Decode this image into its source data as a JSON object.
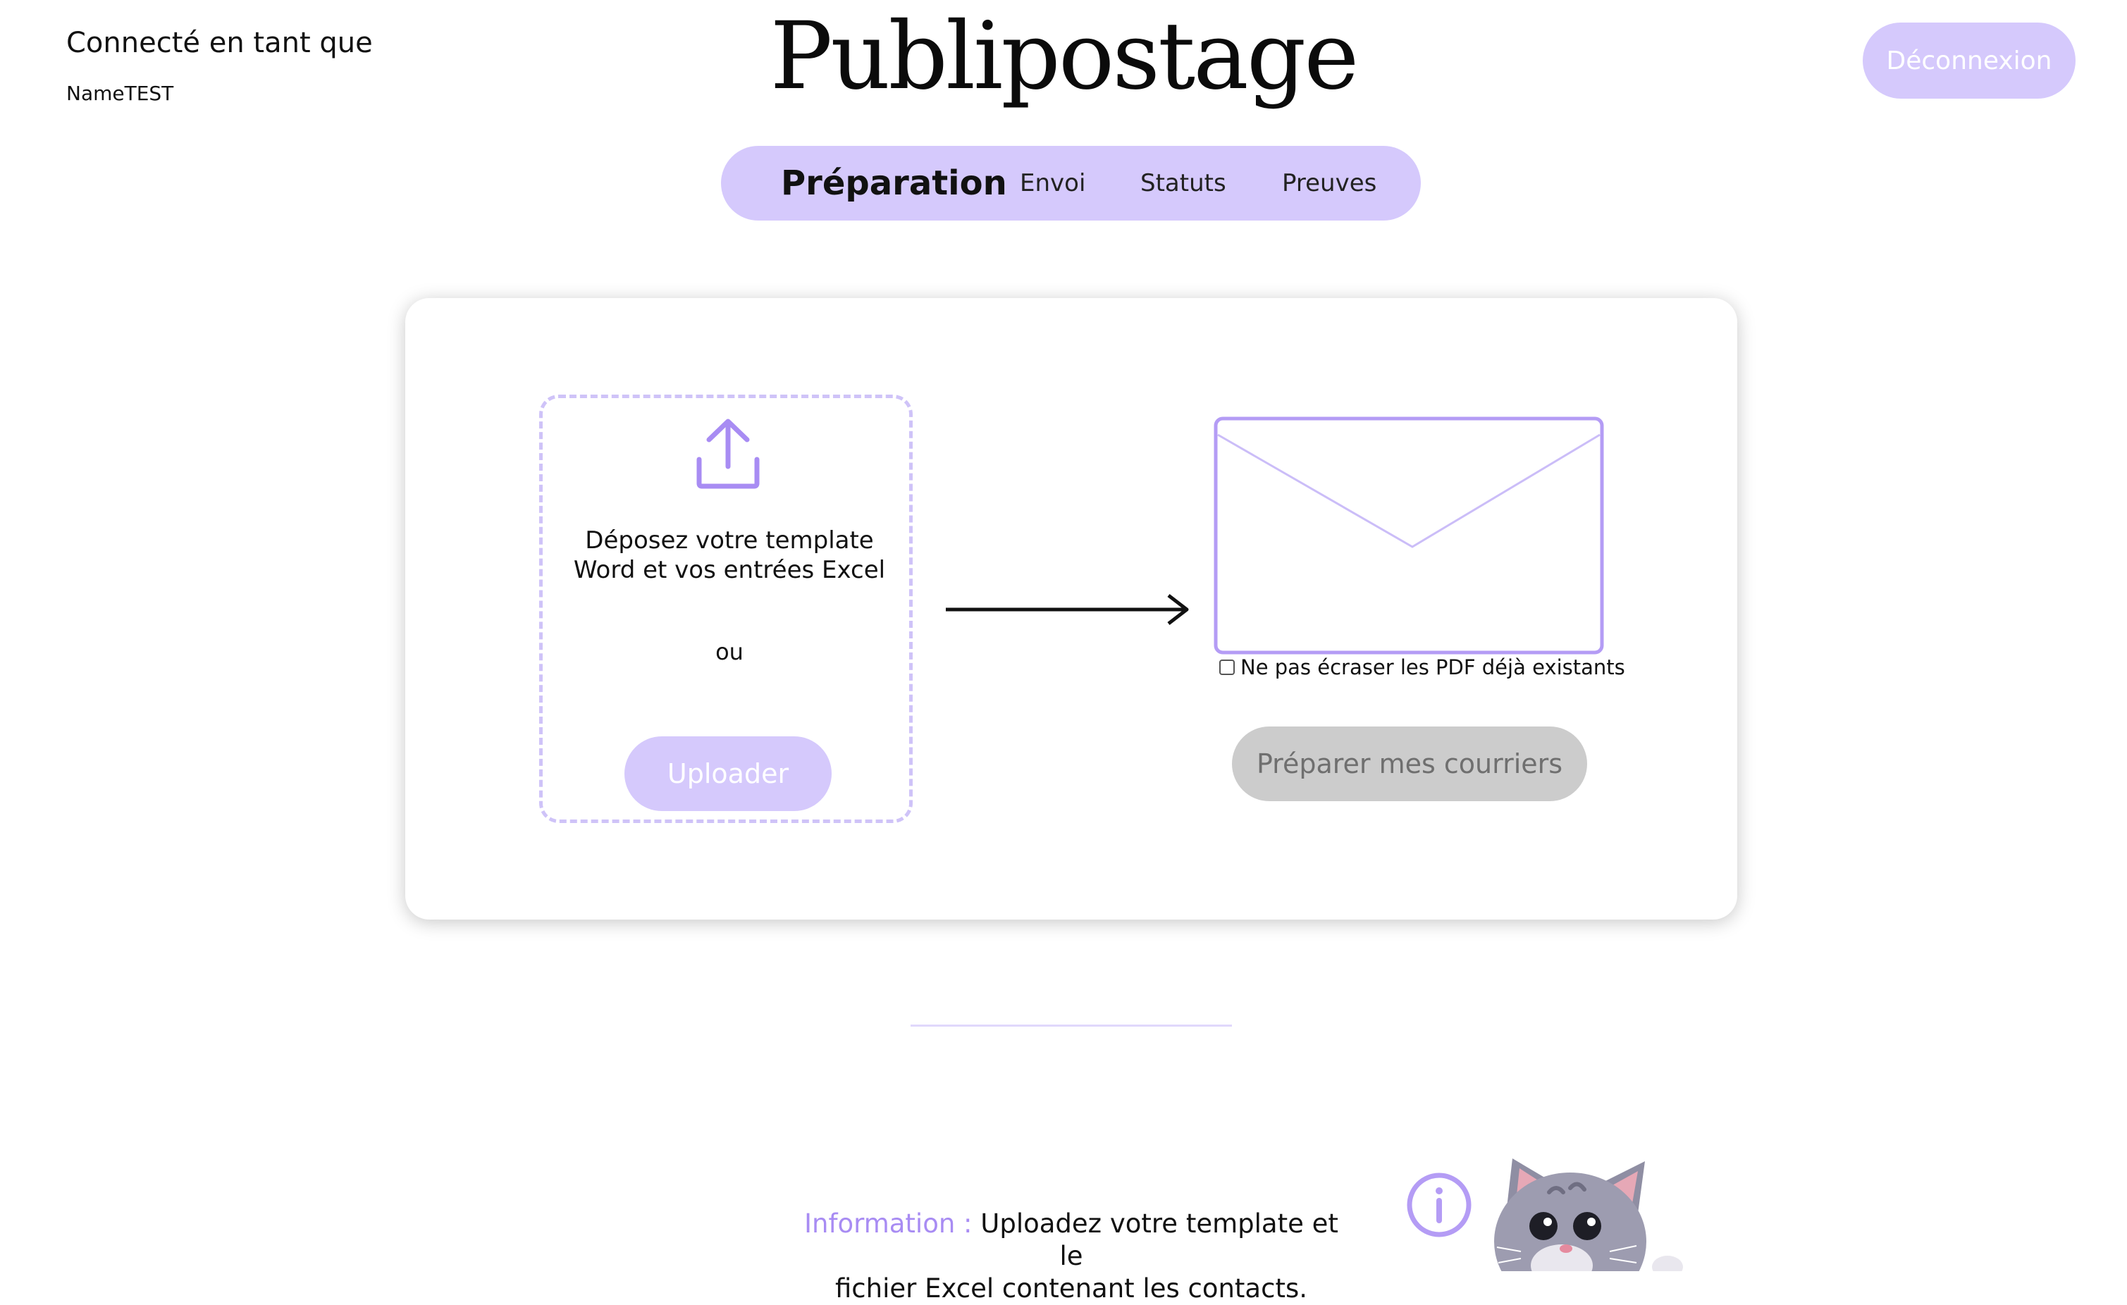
{
  "header": {
    "user_label": "Connecté en tant que",
    "user_name": "NameTEST",
    "app_title": "Publipostage",
    "logout_label": "Déconnexion"
  },
  "tabs": [
    {
      "label": "Préparation",
      "active": true
    },
    {
      "label": "Envoi",
      "active": false
    },
    {
      "label": "Statuts",
      "active": false
    },
    {
      "label": "Preuves",
      "active": false
    }
  ],
  "upload": {
    "drop_text_line1": "Déposez votre template",
    "drop_text_line2": "Word et vos entrées Excel",
    "or_text": "ou",
    "button_label": "Uploader",
    "icon": "upload-icon"
  },
  "prepare": {
    "checkbox_label": "Ne pas écraser les PDF déjà existants",
    "checkbox_checked": false,
    "button_label": "Préparer mes courriers",
    "icon": "envelope-icon"
  },
  "info": {
    "label": "Information :",
    "text_line1": " Uploadez votre template et le",
    "text_line2": "fichier Excel contenant les contacts.",
    "icon": "info-icon",
    "mascot": "cat-mascot"
  },
  "colors": {
    "accent": "#d5c9fc",
    "accent_dark": "#a88cf3",
    "disabled": "#cccccc"
  }
}
